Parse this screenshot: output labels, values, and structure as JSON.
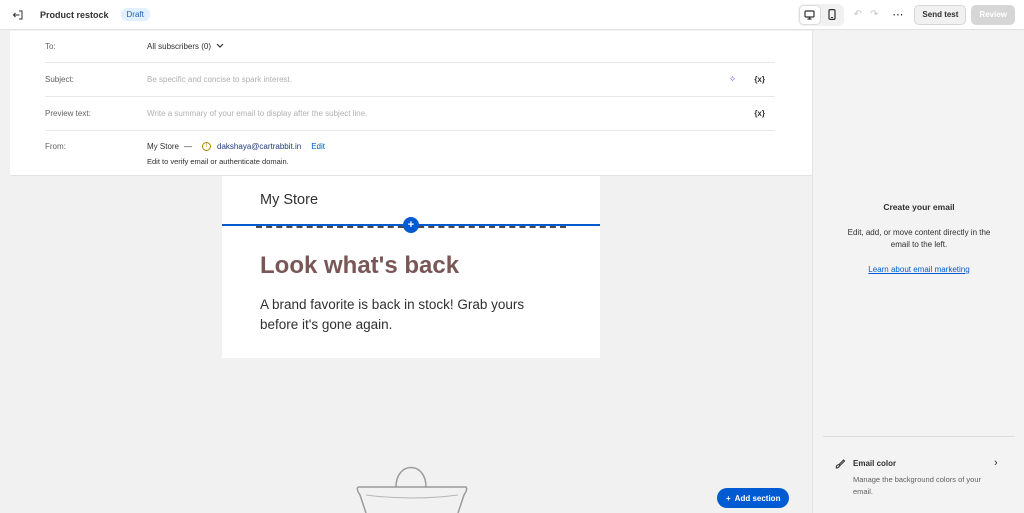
{
  "topbar": {
    "title": "Product restock",
    "status_badge": "Draft",
    "send_test_label": "Send test",
    "review_label": "Review",
    "more_label": "⋯"
  },
  "header": {
    "to_label": "To:",
    "to_value": "All subscribers (0)",
    "subject_label": "Subject:",
    "subject_placeholder": "Be specific and concise to spark interest.",
    "preview_label": "Preview text:",
    "preview_placeholder": "Write a summary of your email to display after the subject line.",
    "variable_label": "{x}",
    "from_label": "From:",
    "from_name": "My Store",
    "from_separator": "—",
    "from_email": "dakshaya@cartrabbit.in",
    "edit_label": "Edit",
    "from_hint": "Edit to verify email or authenticate domain."
  },
  "email": {
    "store_name": "My Store",
    "headline": "Look what's back",
    "body": "A brand favorite is back in stock! Grab yours before it's gone again."
  },
  "canvas": {
    "add_section_label": "Add section"
  },
  "panel": {
    "title": "Create your email",
    "description": "Edit, add, or move content directly in the email to the left.",
    "link": "Learn about email marketing",
    "email_color_title": "Email color",
    "email_color_desc": "Manage the background colors of your email."
  },
  "colors": {
    "accent": "#005bd3",
    "headline": "#7a5656"
  }
}
